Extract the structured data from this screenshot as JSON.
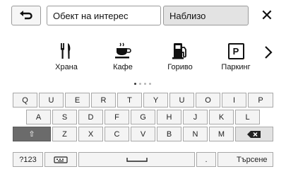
{
  "top_bar": {
    "poi_field": "Обект на интерес",
    "nearby_field": "Наблизо",
    "close_symbol": "✕"
  },
  "categories": [
    {
      "icon": "fork-knife-icon",
      "label": "Храна"
    },
    {
      "icon": "coffee-cup-icon",
      "label": "Кафе"
    },
    {
      "icon": "fuel-pump-icon",
      "label": "Гориво"
    },
    {
      "icon": "parking-icon",
      "label": "Паркинг",
      "glyph": "P"
    }
  ],
  "page_indicator": {
    "pages": 4,
    "active": 1
  },
  "keyboard": {
    "row1": [
      "Q",
      "U",
      "E",
      "R",
      "T",
      "Y",
      "U",
      "O",
      "I",
      "P"
    ],
    "row2": [
      "A",
      "S",
      "D",
      "F",
      "G",
      "H",
      "J",
      "K",
      "L"
    ],
    "row3": [
      "Z",
      "X",
      "C",
      "V",
      "B",
      "N",
      "M"
    ],
    "shift_symbol": "⇧",
    "numbers_key": "?123",
    "period_key": ".",
    "search_key": "Търсене"
  }
}
